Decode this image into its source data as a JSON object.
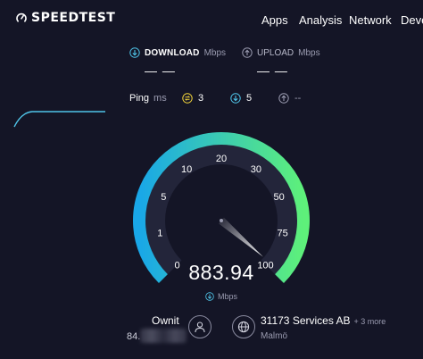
{
  "header": {
    "logo_text": "SPEEDTEST",
    "nav": [
      "Apps",
      "Analysis",
      "Network",
      "Deve"
    ]
  },
  "download": {
    "label": "DOWNLOAD",
    "unit": "Mbps",
    "value": "— —"
  },
  "upload": {
    "label": "UPLOAD",
    "unit": "Mbps",
    "value": "— —"
  },
  "ping": {
    "label": "Ping",
    "unit": "ms",
    "idle": "3",
    "download": "5",
    "upload": "--"
  },
  "gauge": {
    "ticks": [
      "0",
      "1",
      "5",
      "10",
      "20",
      "30",
      "50",
      "75",
      "100"
    ],
    "current": "883.94",
    "unit": "Mbps"
  },
  "provider": {
    "name": "Ownit",
    "ip": "84."
  },
  "server": {
    "name": "31173 Services AB",
    "more": "+ 3 more",
    "city": "Malmö"
  },
  "colors": {
    "background": "#141526",
    "gauge_start": "#19a7e8",
    "gauge_end": "#5ef07a",
    "download_accent": "#4fc4e8",
    "idle_ping": "#f1d33a",
    "download_ping": "#4fc4e8",
    "upload_ping": "#9a9bb0"
  }
}
